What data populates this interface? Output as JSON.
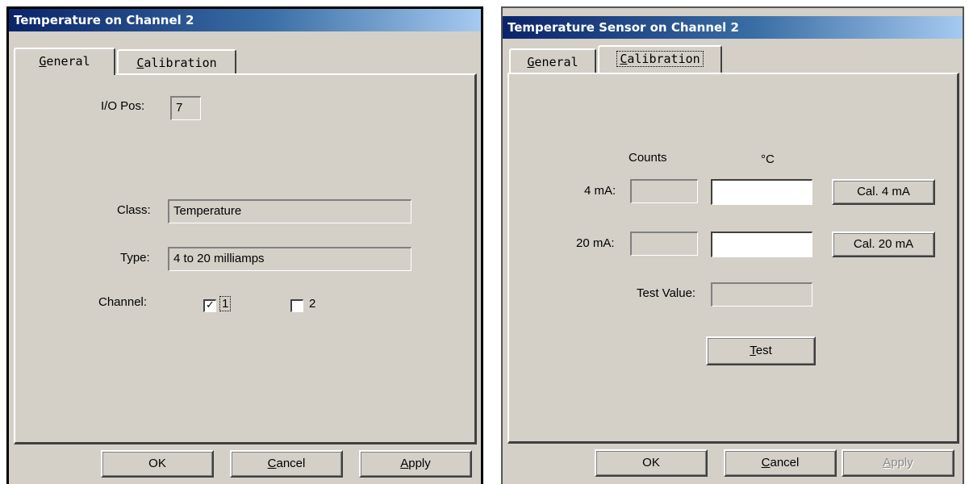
{
  "left_dialog": {
    "title": "Temperature on Channel 2",
    "tabs": [
      {
        "label_first": "G",
        "label_rest": "eneral",
        "active": true
      },
      {
        "label_first": "C",
        "label_rest": "alibration",
        "active": false
      }
    ],
    "io_pos": {
      "label": "I/O Pos:",
      "value": "7"
    },
    "class_field": {
      "label": "Class:",
      "value": "Temperature"
    },
    "type_field": {
      "label": "Type:",
      "value": "4 to 20 milliamps"
    },
    "channel": {
      "label": "Channel:",
      "options": [
        {
          "label": "1",
          "checked": true
        },
        {
          "label": "2",
          "checked": false
        }
      ]
    },
    "buttons": {
      "ok": "OK",
      "cancel_first": "C",
      "cancel_rest": "ancel",
      "apply_first": "A",
      "apply_rest": "pply"
    }
  },
  "right_dialog": {
    "title": "Temperature Sensor on Channel 2",
    "tabs": [
      {
        "label_first": "G",
        "label_rest": "eneral",
        "active": false
      },
      {
        "label_first": "C",
        "label_rest": "alibration",
        "active": true
      }
    ],
    "headers": {
      "counts": "Counts",
      "unit": "°C"
    },
    "rows": [
      {
        "label": "4 mA:",
        "counts": "",
        "value": "",
        "button": "Cal. 4 mA"
      },
      {
        "label": "20 mA:",
        "counts": "",
        "value": "",
        "button": "Cal. 20 mA"
      }
    ],
    "test_value": {
      "label": "Test Value:",
      "value": ""
    },
    "test_button": {
      "first": "T",
      "rest": "est"
    },
    "buttons": {
      "ok": "OK",
      "cancel_first": "C",
      "cancel_rest": "ancel",
      "apply_first": "A",
      "apply_rest": "pply",
      "apply_disabled": true
    }
  }
}
